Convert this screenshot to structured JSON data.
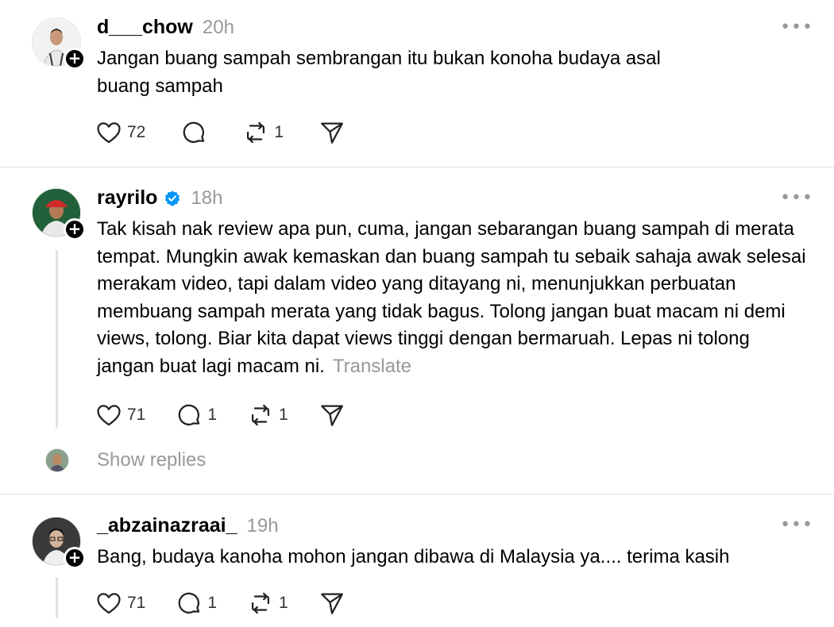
{
  "posts": [
    {
      "username": "d___chow",
      "time": "20h",
      "text": "Jangan buang sampah sembrangan itu bukan konoha budaya asal buang sampah",
      "likes": "72",
      "comments": "",
      "reposts": "1"
    },
    {
      "username": "rayrilo",
      "time": "18h",
      "verified": true,
      "text": "Tak kisah nak review apa pun, cuma, jangan sebarangan buang sampah di merata tempat. Mungkin awak kemaskan dan buang sampah tu sebaik sahaja awak selesai merakam video, tapi dalam video yang ditayang ni, menunjukkan perbuatan membuang sampah merata yang tidak bagus. Tolong jangan buat macam ni demi views, tolong. Biar kita dapat views tinggi dengan bermaruah. Lepas ni tolong jangan buat lagi macam ni.",
      "translate_label": "Translate",
      "likes": "71",
      "comments": "1",
      "reposts": "1",
      "show_replies_label": "Show replies"
    },
    {
      "username": "_abzainazraai_",
      "time": "19h",
      "text": "Bang, budaya kanoha mohon jangan dibawa di Malaysia ya.... terima kasih",
      "likes": "71",
      "comments": "1",
      "reposts": "1"
    }
  ],
  "icons": {
    "more": "more-options-icon",
    "like": "heart-icon",
    "comment": "comment-icon",
    "repost": "repost-icon",
    "share": "share-icon",
    "follow": "plus-icon",
    "verified": "verified-badge-icon"
  },
  "colors": {
    "verified": "#0095f6",
    "muted": "#999999",
    "divider": "#e1e1e1"
  }
}
